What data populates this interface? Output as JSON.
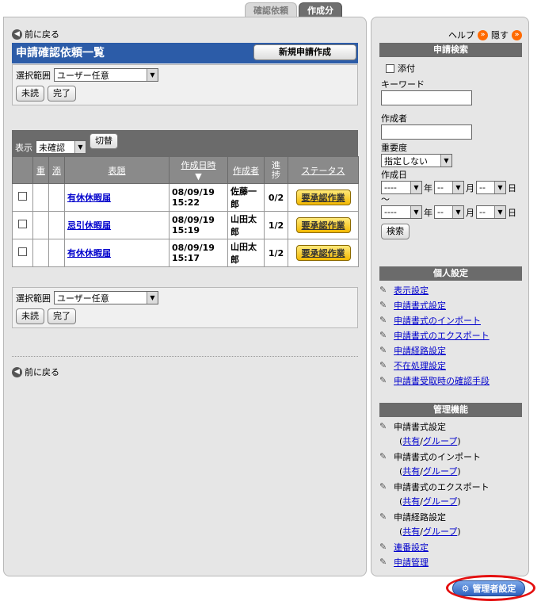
{
  "tabs": {
    "confirm": "確認依頼",
    "created": "作成分"
  },
  "main": {
    "back_label": "前に戻る",
    "title": "申請確認依頼一覧",
    "new_button": "新規申請作成",
    "filter": {
      "label": "選択範囲",
      "selected": "ユーザー任意",
      "unread": "未読",
      "done": "完了"
    },
    "display": {
      "label": "表示",
      "selected": "未確認",
      "switch": "切替"
    },
    "columns": {
      "important": "重",
      "attach": "添",
      "subject": "表題",
      "created_at": "作成日時",
      "sort_mark": "▼",
      "author": "作成者",
      "progress": "進捗",
      "status": "ステータス"
    },
    "rows": [
      {
        "subject": "有休休暇届",
        "date": "08/09/19",
        "time": "15:22",
        "author": "佐藤一郎",
        "progress": "0/2",
        "status": "要承認作業"
      },
      {
        "subject": "忌引休暇届",
        "date": "08/09/19",
        "time": "15:19",
        "author": "山田太郎",
        "progress": "1/2",
        "status": "要承認作業"
      },
      {
        "subject": "有休休暇届",
        "date": "08/09/19",
        "time": "15:17",
        "author": "山田太郎",
        "progress": "1/2",
        "status": "要承認作業"
      }
    ]
  },
  "side": {
    "help": "ヘルプ",
    "hide": "隠す",
    "search": {
      "header": "申請検索",
      "attach": "添付",
      "keyword": "キーワード",
      "author": "作成者",
      "importance": "重要度",
      "importance_value": "指定しない",
      "created": "作成日",
      "date_blank": "----",
      "mm_blank": "--",
      "year": "年",
      "month": "月",
      "day": "日",
      "tilde": "～",
      "search_button": "検索"
    },
    "personal": {
      "header": "個人設定",
      "items": [
        "表示設定",
        "申請書式設定",
        "申請書式のインポート",
        "申請書式のエクスポート",
        "申請経路設定",
        "不在処理設定",
        "申請書受取時の確認手段"
      ]
    },
    "admin": {
      "header": "管理機能",
      "items": [
        "申請書式設定",
        "申請書式のインポート",
        "申請書式のエクスポート",
        "申請経路設定"
      ],
      "shared": "共有",
      "group": "グループ",
      "slash": "/",
      "paren_open": "(",
      "paren_close": ")",
      "links": [
        "連番設定",
        "申請管理"
      ]
    }
  },
  "admin_button": "管理者設定"
}
